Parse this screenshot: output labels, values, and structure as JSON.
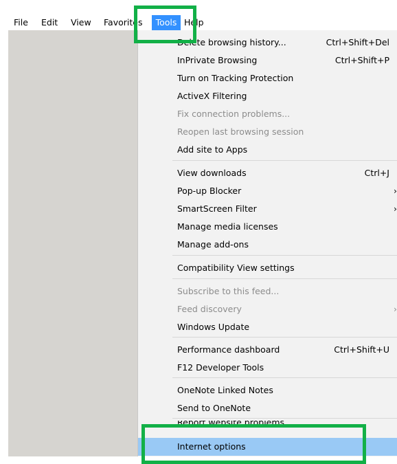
{
  "menubar": {
    "file": "File",
    "edit": "Edit",
    "view": "View",
    "favorites": "Favorites",
    "tools": "Tools",
    "help": "Help"
  },
  "tools_menu": {
    "delete_history": {
      "label": "Delete browsing history...",
      "shortcut": "Ctrl+Shift+Del"
    },
    "inprivate": {
      "label": "InPrivate Browsing",
      "shortcut": "Ctrl+Shift+P"
    },
    "tracking": {
      "label": "Turn on Tracking Protection"
    },
    "activex": {
      "label": "ActiveX Filtering"
    },
    "fix_connection": {
      "label": "Fix connection problems..."
    },
    "reopen_session": {
      "label": "Reopen last browsing session"
    },
    "add_site_apps": {
      "label": "Add site to Apps"
    },
    "view_downloads": {
      "label": "View downloads",
      "shortcut": "Ctrl+J"
    },
    "popup_blocker": {
      "label": "Pop-up Blocker"
    },
    "smartscreen": {
      "label": "SmartScreen Filter"
    },
    "media_licenses": {
      "label": "Manage media licenses"
    },
    "addons": {
      "label": "Manage add-ons"
    },
    "compat_view": {
      "label": "Compatibility View settings"
    },
    "subscribe_feed": {
      "label": "Subscribe to this feed..."
    },
    "feed_discovery": {
      "label": "Feed discovery"
    },
    "windows_update": {
      "label": "Windows Update"
    },
    "perf_dashboard": {
      "label": "Performance dashboard",
      "shortcut": "Ctrl+Shift+U"
    },
    "f12_tools": {
      "label": "F12 Developer Tools"
    },
    "onenote_linked": {
      "label": "OneNote Linked Notes"
    },
    "send_onenote": {
      "label": "Send to OneNote"
    },
    "report_problems": {
      "label": "Report website problems"
    },
    "internet_options": {
      "label": "Internet options"
    },
    "chevron_glyph": "›"
  },
  "colors": {
    "highlight_green": "#12b047",
    "tools_active": "#3391ff",
    "selected_item": "#99c9f5"
  }
}
